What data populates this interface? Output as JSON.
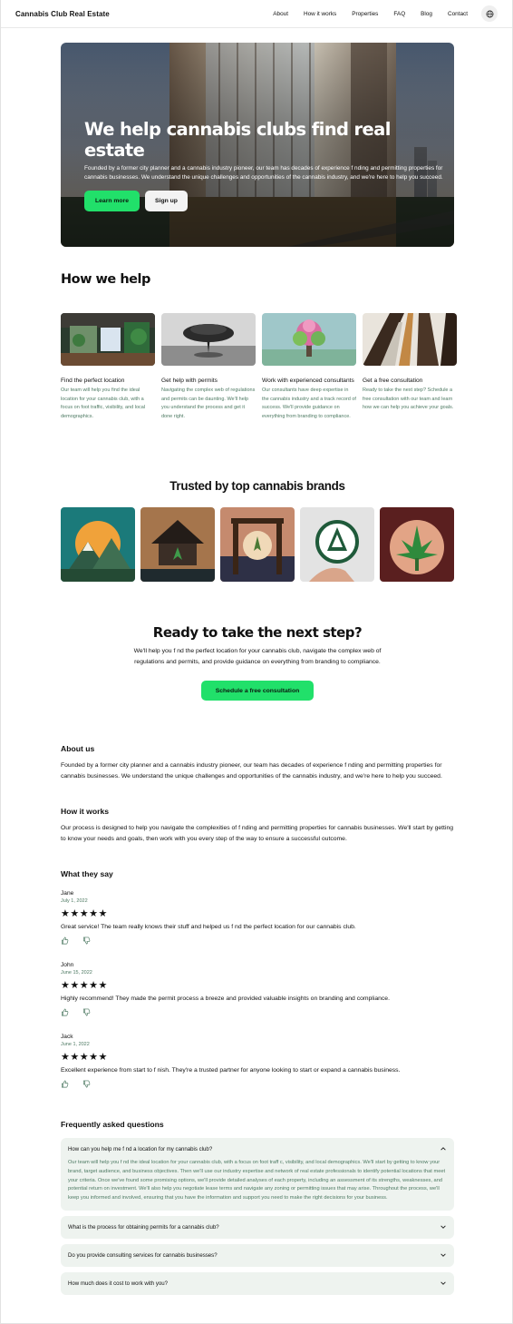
{
  "header": {
    "brand": "Cannabis Club Real Estate",
    "nav": [
      "About",
      "How it works",
      "Properties",
      "FAQ",
      "Blog",
      "Contact"
    ],
    "globe_icon": "globe-icon"
  },
  "hero": {
    "title": "We help cannabis clubs find real estate",
    "text": "Founded by a former city planner and a cannabis industry pioneer, our team has decades of experience f nding and permitting properties for cannabis businesses. We understand the unique challenges and opportunities of the cannabis industry, and we're here to help you succeed.",
    "primary_button": "Learn more",
    "secondary_button": "Sign up"
  },
  "how_we_help": {
    "heading": "How we help",
    "cards": [
      {
        "title": "Find the perfect location",
        "text": "Our team will help you find the ideal location for your cannabis club, with a focus on foot traffic, visibility, and local demographics."
      },
      {
        "title": "Get help with permits",
        "text": "Navigating the complex web of regulations and permits can be daunting. We'll help you understand the process and get it done right."
      },
      {
        "title": "Work with experienced consultants",
        "text": "Our consultants have deep expertise in the cannabis industry and a track record of success. We'll provide guidance on everything from branding to compliance."
      },
      {
        "title": "Get a free consultation",
        "text": "Ready to take the next step? Schedule a free consultation with our team and learn how we can help you achieve your goals."
      }
    ]
  },
  "trusted": {
    "heading": "Trusted by top cannabis brands"
  },
  "cta": {
    "heading": "Ready to take the next step?",
    "text_line1": "We'll help you f nd the perfect location for your cannabis club, navigate the complex web of",
    "text_line2": "regulations and permits, and provide guidance on everything from branding to compliance.",
    "button": "Schedule a free consultation"
  },
  "about": {
    "heading": "About us",
    "text": "Founded by a former city planner and a cannabis industry pioneer, our team has decades of experience f nding and permitting properties for cannabis businesses. We understand the unique challenges and opportunities of the cannabis industry, and we're here to help you succeed."
  },
  "how_it_works": {
    "heading": "How it works",
    "text": "Our process is designed to help you navigate the complexities of f nding and permitting properties for cannabis businesses. We'll start by getting to know your needs and goals, then work with you every step of the way to ensure a successful outcome."
  },
  "reviews": {
    "heading": "What they say",
    "items": [
      {
        "name": "Jane",
        "date": "July 1, 2022",
        "stars": "★★★★★",
        "rating": 5,
        "text": "Great service! The team really knows their stuff and helped us f nd the perfect location for our cannabis club."
      },
      {
        "name": "John",
        "date": "June 15, 2022",
        "stars": "★★★★★",
        "rating": 5,
        "text": "Highly recommend! They made the permit process a breeze and provided valuable insights on branding and compliance."
      },
      {
        "name": "Jack",
        "date": "June 1, 2022",
        "stars": "★★★★★",
        "rating": 5,
        "text": "Excellent experience from start to f nish. They're a trusted partner for anyone looking to start or expand a cannabis business."
      }
    ]
  },
  "faq": {
    "heading": "Frequently asked questions",
    "open": {
      "question": "How can you help me f nd a location for my cannabis club?",
      "answer": "Our team will help you f nd the ideal location for your cannabis club, with a focus on foot traff c, visibility, and local demographics. We'll start by getting to know your brand, target audience, and business objectives. Then we'll use our industry expertise and network of real estate professionals to identify potential locations that meet your criteria. Once we've found some promising options, we'll provide detailed analyses of each property, including an assessment of its strengths, weaknesses, and potential return on investment. We'll also help you negotiate lease terms and navigate any zoning or permitting issues that may arise. Throughout the process, we'll keep you informed and involved, ensuring that you have the information and support you need to make the right decisions for your business."
    },
    "closed": [
      "What is the process for obtaining permits for a cannabis club?",
      "Do you provide consulting services for cannabis businesses?",
      "How much does it cost to work with you?"
    ]
  },
  "colors": {
    "accent": "#21e06a",
    "muted_text": "#4e7a63",
    "faq_bg": "#eef3ef"
  }
}
